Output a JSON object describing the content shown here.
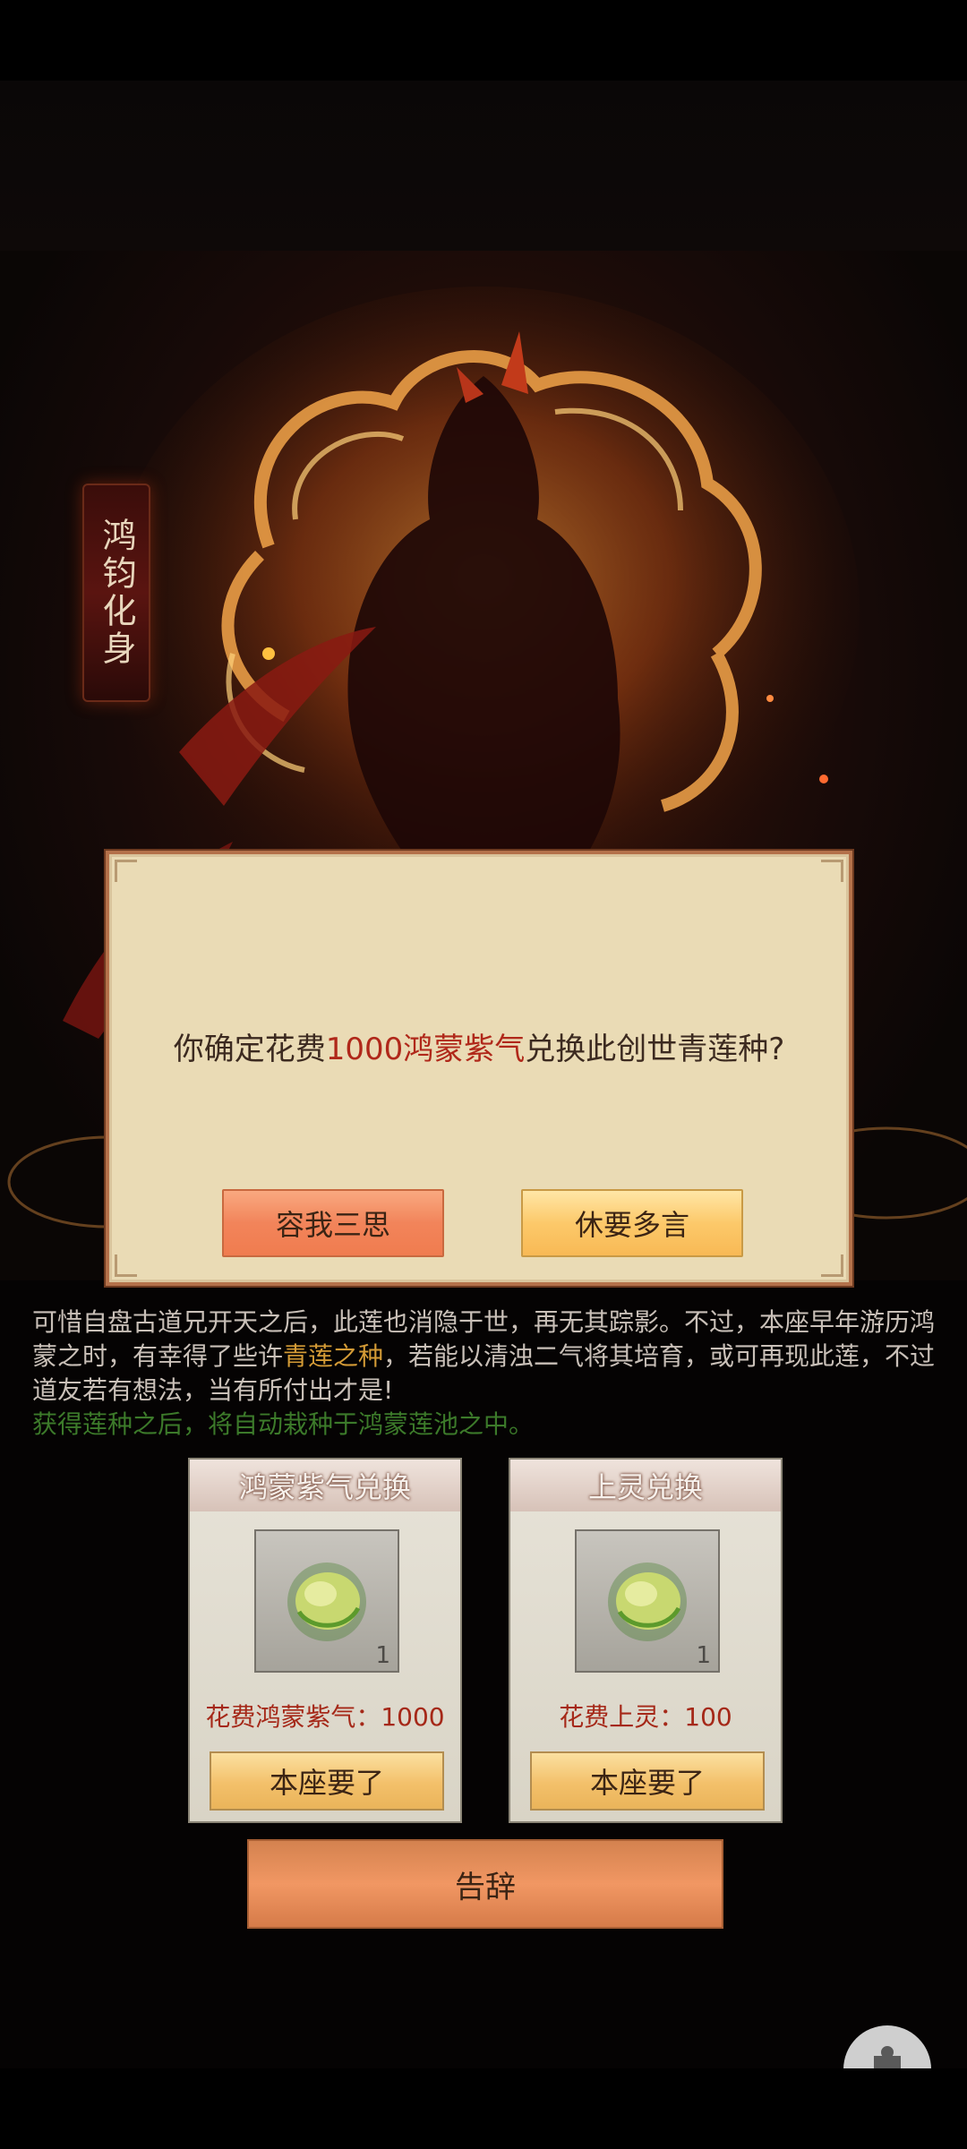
{
  "character": {
    "name_vertical": "鸿钧化身"
  },
  "dialog": {
    "message_prefix": "你确定花费",
    "message_highlight": "1000鸿蒙紫气",
    "message_suffix": "兑换此创世青莲种?",
    "cancel_label": "容我三思",
    "confirm_label": "休要多言"
  },
  "description": {
    "line_part1": "可惜自盘古道兄开天之后，此莲也消隐于世，再无其踪影。不过，本座早年游历鸿蒙之时，有幸得了些许",
    "highlight": "青莲之种",
    "line_part2": "，若能以清浊二气将其培育，或可再现此莲，不过道友若有想法，当有所付出才是!",
    "note": "获得莲种之后，将自动栽种于鸿蒙莲池之中。"
  },
  "exchange_cards": [
    {
      "title": "鸿蒙紫气兑换",
      "item_icon": "lotus-seed-icon",
      "item_count": "1",
      "cost_text": "花费鸿蒙紫气：1000",
      "button_label": "本座要了"
    },
    {
      "title": "上灵兑换",
      "item_icon": "lotus-seed-icon",
      "item_count": "1",
      "cost_text": "花费上灵：100",
      "button_label": "本座要了"
    }
  ],
  "footer": {
    "leave_label": "告辞"
  },
  "colors": {
    "highlight_red": "#b0281a",
    "gold_text": "#d49b36",
    "note_green": "#3c7a2a"
  }
}
